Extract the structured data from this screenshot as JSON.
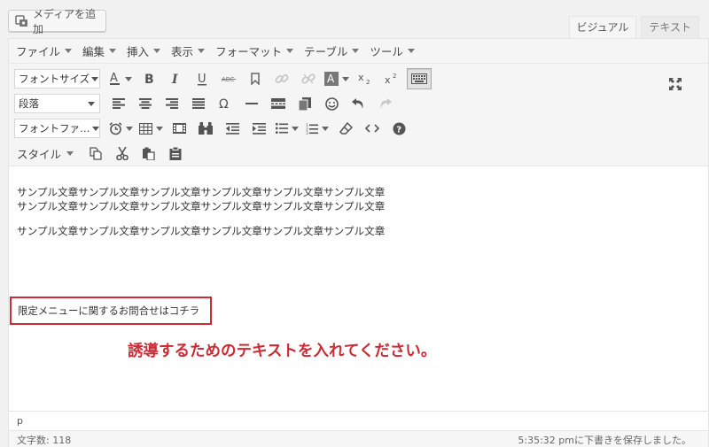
{
  "media_button": {
    "label": "メディアを追加",
    "icon": "media-icon"
  },
  "mode_tabs": [
    {
      "label": "ビジュアル",
      "active": true
    },
    {
      "label": "テキスト",
      "active": false
    }
  ],
  "menubar": [
    "ファイル",
    "編集",
    "挿入",
    "表示",
    "フォーマット",
    "テーブル",
    "ツール"
  ],
  "toolbar": {
    "font_size": "フォントサイズ",
    "format": "段落",
    "font_family": "フォントファ…",
    "styles": "スタイル"
  },
  "content": {
    "paragraph1": [
      "サンプル文章サンプル文章サンプル文章サンプル文章サンプル文章サンプル文章",
      "サンプル文章サンプル文章サンプル文章サンプル文章サンプル文章サンプル文章"
    ],
    "paragraph2": "サンプル文章サンプル文章サンプル文章サンプル文章サンプル文章サンプル文章",
    "highlight_text": "限定メニューに関するお問合せはコチラ",
    "annotation": "誘導するためのテキストを入れてください。"
  },
  "path": "p",
  "status": {
    "word_count": "文字数: 118",
    "draft_saved": "5:35:32 pmに下書きを保存しました。"
  },
  "colors": {
    "annotation": "#cc2b35",
    "box_border": "#cc2b35"
  }
}
